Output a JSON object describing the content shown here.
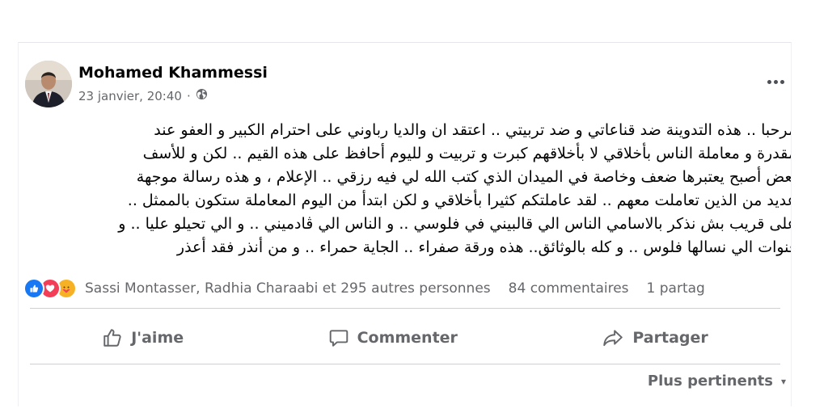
{
  "post": {
    "author": "Mohamed Khammessi",
    "date": "23 janvier, 20:40",
    "separator": "·",
    "lines": [
      "مرحبا .. هذه التدوينة ضد قناعاتي و ضد تربيتي .. اعتقد ان والديا رباوني على احترام الكبير و العفو عند",
      "مقدرة و معاملة الناس بأخلاقي لا بأخلاقهم كبرت و تربيت و لليوم أحافظ على هذه القيم .. لكن و للأسف",
      "بعض أصبح يعتبرها ضعف وخاصة في الميدان الذي كتب الله لي فيه رزقي .. الإعلام ، و هذه رسالة موجهة",
      "عديد من الذين تعاملت معهم .. لقد عاملتكم كثيرا بأخلاقي و لكن ابتدأ من اليوم المعاملة ستكون بالممثل ..",
      "على قريب بش نذكر بالاسامي الناس الي قالبيني في فلوسي .. و الناس الي ڤادميني .. و الي تحيلو عليا .. و",
      "قنوات الي نسالها فلوس .. و كله بالوثائق.. هذه ورقة صفراء .. الجاية حمراء .. و من أنذر فقد أعذر"
    ]
  },
  "stats": {
    "reacted_names": "Sassi Montasser, Radhia Charaabi et 295 autres personnes",
    "comments": "84 commentaires",
    "shares": "1 partag"
  },
  "actions": {
    "like": "J'aime",
    "comment": "Commenter",
    "share": "Partager"
  },
  "sort": {
    "label": "Plus pertinents",
    "caret": "▾"
  },
  "icons": [
    "more-options-icon",
    "globe-icon",
    "like-reaction-icon",
    "love-reaction-icon",
    "care-reaction-icon",
    "thumbs-up-icon",
    "comment-icon",
    "share-icon"
  ],
  "colors": {
    "text": "#050505",
    "secondary": "#65676b",
    "like_blue": "#1877f2",
    "love_red": "#f33e58",
    "care_yellow": "#f7b125"
  }
}
